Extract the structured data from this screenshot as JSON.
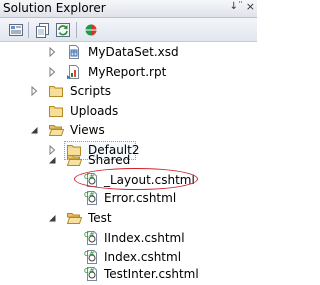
{
  "panel": {
    "title": "Solution Explorer",
    "pin_glyph": "↓¨",
    "close_glyph": "×"
  },
  "toolbar": {
    "buttons": [
      {
        "icon": "properties-icon"
      },
      {
        "icon": "show-all-files-icon"
      },
      {
        "icon": "refresh-icon"
      },
      {
        "icon": "class-diagram-icon"
      }
    ]
  },
  "tree": {
    "items": [
      {
        "label": "MyDataSet.xsd",
        "icon": "dataset-file-icon"
      },
      {
        "label": "MyReport.rpt",
        "icon": "report-file-icon"
      },
      {
        "label": "Scripts",
        "icon": "folder-icon"
      },
      {
        "label": "Uploads",
        "icon": "folder-icon"
      },
      {
        "label": "Views",
        "icon": "folder-open-icon"
      },
      {
        "label": "Default2",
        "icon": "folder-icon"
      },
      {
        "label": "Shared",
        "icon": "folder-open-icon"
      },
      {
        "label": "_Layout.cshtml",
        "icon": "cshtml-file-icon"
      },
      {
        "label": "Error.cshtml",
        "icon": "cshtml-file-icon"
      },
      {
        "label": "Test",
        "icon": "folder-open-icon"
      },
      {
        "label": "IIndex.cshtml",
        "icon": "cshtml-file-icon"
      },
      {
        "label": "Index.cshtml",
        "icon": "cshtml-file-icon"
      },
      {
        "label": "TestInter.cshtml",
        "icon": "cshtml-file-icon"
      }
    ]
  },
  "colors": {
    "highlight_ellipse": "#d21f2a",
    "folder": "#e9c46a",
    "selection_border": "#7da2ce"
  }
}
